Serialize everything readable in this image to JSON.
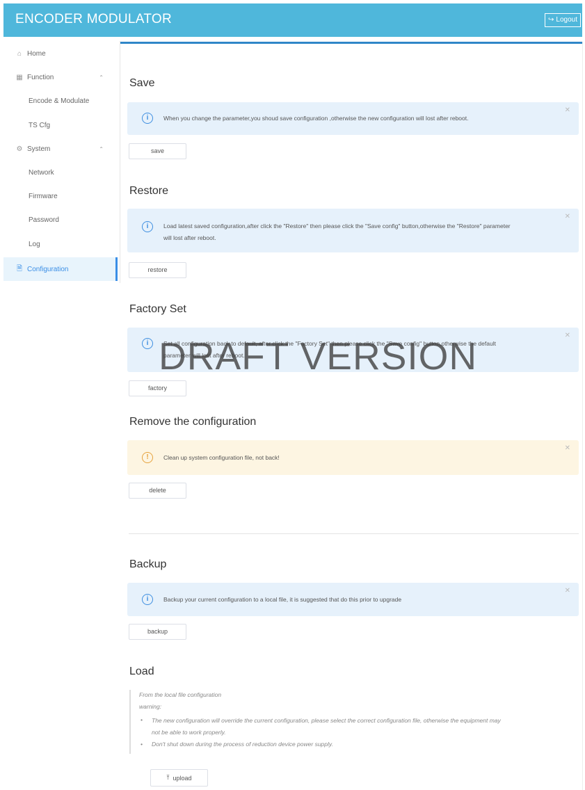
{
  "header": {
    "title": "ENCODER MODULATOR",
    "logout_label": "Logout",
    "logout_icon": "logout-icon"
  },
  "sidebar": {
    "items": [
      {
        "label": "Home",
        "icon": "home-icon"
      },
      {
        "label": "Function",
        "icon": "grid-icon"
      },
      {
        "label": "Encode & Modulate"
      },
      {
        "label": "TS Cfg"
      },
      {
        "label": "System",
        "icon": "gear-icon"
      },
      {
        "label": "Network"
      },
      {
        "label": "Firmware"
      },
      {
        "label": "Password"
      },
      {
        "label": "Log"
      },
      {
        "label": "Configuration",
        "icon": "document-icon"
      }
    ]
  },
  "sections": {
    "save": {
      "title": "Save",
      "alert": "When you change the parameter,you shoud save configuration ,otherwise the new configuration will lost after reboot.",
      "button": "save"
    },
    "restore": {
      "title": "Restore",
      "alert_line1": "Load latest saved configuration,after click the \"Restore\" then please click the \"Save config\" button,otherwise the \"Restore\" parameter",
      "alert_line2": "will lost after reboot.",
      "button": "restore"
    },
    "factory": {
      "title": "Factory Set",
      "alert_line1": "Set all configuration back to default, after click the \"Factory Set\" then please click the \"Save config\" button,otherwise the default",
      "alert_line2": "parameter will lost after reboot.",
      "button": "factory"
    },
    "remove": {
      "title": "Remove the configuration",
      "alert": "Clean up system configuration file, not back!",
      "button": "delete"
    },
    "backup": {
      "title": "Backup",
      "alert": "Backup your current configuration to a local file, it is suggested that do this prior to upgrade",
      "button": "backup"
    },
    "load": {
      "title": "Load",
      "line1": "From the local file configuration",
      "line2": "warning:",
      "bullet1_line1": "The new configuration will override the current configuration, please select the correct configuration file, otherwise the equipment may",
      "bullet1_line2": "not be able to work properly.",
      "bullet2": "Don't shut down during the process of reduction device power supply.",
      "button": "upload"
    }
  },
  "watermark": "DRAFT VERSION",
  "colors": {
    "header": "#4fb7db",
    "accent": "#3a8ee6",
    "info_bg": "#e6f1fb",
    "warn_bg": "#fdf5e2"
  }
}
